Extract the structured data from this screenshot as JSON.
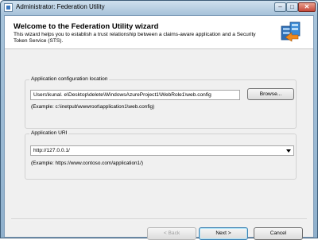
{
  "window": {
    "title": "Administrator: Federation Utility",
    "controls": {
      "minimize": "–",
      "maximize": "□",
      "close": "✕"
    }
  },
  "header": {
    "title": "Welcome to the Federation Utility wizard",
    "description": "This wizard helps you to establish a trust relationship between a claims-aware application and a Security Token Service (STS)."
  },
  "config_group": {
    "label": "Application configuration location",
    "value": "Users\\kunal.          e\\Desktop\\delete\\WindowsAzureProject1\\WebRole1\\web.config",
    "browse_label": "Browse...",
    "example": "(Example:  c:\\inetpub\\wwwroot\\application1\\web.config)"
  },
  "uri_group": {
    "label": "Application URI",
    "value": "http://127.0.0.1/",
    "example": "(Example: https://www.contoso.com/application1/)"
  },
  "footer": {
    "back_label": "< Back",
    "next_label": "Next >",
    "cancel_label": "Cancel"
  },
  "icons": {
    "app": "window-app-icon",
    "wizard": "federation-wizard-icon"
  }
}
